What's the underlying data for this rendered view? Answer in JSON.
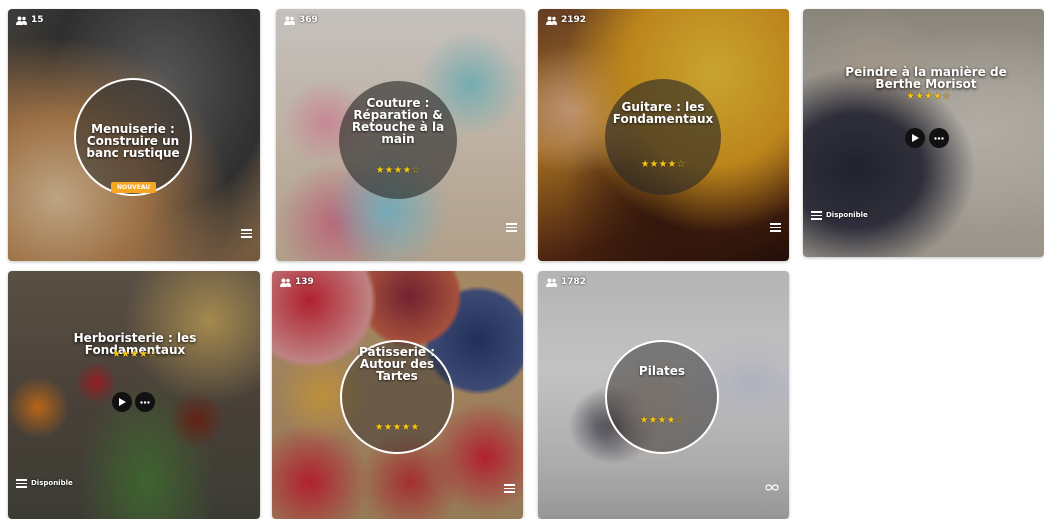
{
  "cards": [
    {
      "count": "15",
      "title": "Menuiserie : Construire un banc rustique",
      "badge": "NOUVEAU"
    },
    {
      "count": "369",
      "title": "Couture : Réparation & Retouche à la main",
      "stars": "★★★★☆"
    },
    {
      "count": "2192",
      "title": "Guitare : les Fondamentaux",
      "stars": "★★★★☆"
    },
    {
      "title": "Peindre à la manière de Berthe Morisot",
      "stars": "★★★★☆",
      "status": "Disponible"
    },
    {
      "title": "Herboristerie : les Fondamentaux",
      "stars": "★★★★☆",
      "status": "Disponible"
    },
    {
      "count": "139",
      "title": "Pâtisserie : Autour des Tartes",
      "stars": "★★★★★"
    },
    {
      "count": "1782",
      "title": "Pilates",
      "stars": "★★★★☆"
    }
  ]
}
